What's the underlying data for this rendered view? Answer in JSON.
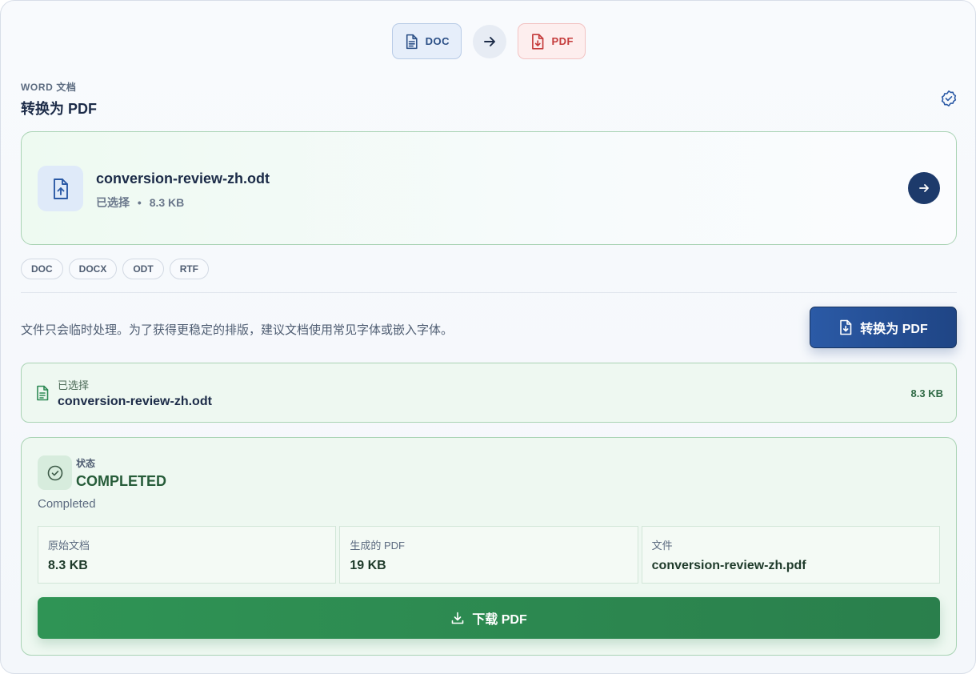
{
  "conversion": {
    "from_label": "DOC",
    "to_label": "PDF"
  },
  "header": {
    "eyebrow": "WORD 文档",
    "title": "转换为 PDF"
  },
  "file": {
    "name": "conversion-review-zh.odt",
    "status": "已选择",
    "separator": "•",
    "size": "8.3 KB"
  },
  "formats": [
    "DOC",
    "DOCX",
    "ODT",
    "RTF"
  ],
  "note": "文件只会临时处理。为了获得更稳定的排版，建议文档使用常见字体或嵌入字体。",
  "convert_button": "转换为 PDF",
  "selected": {
    "label": "已选择",
    "name": "conversion-review-zh.odt",
    "size": "8.3 KB"
  },
  "status": {
    "label": "状态",
    "value": "COMPLETED",
    "description": "Completed",
    "stats": [
      {
        "label": "原始文档",
        "value": "8.3 KB"
      },
      {
        "label": "生成的 PDF",
        "value": "19 KB"
      },
      {
        "label": "文件",
        "value": "conversion-review-zh.pdf"
      }
    ]
  },
  "download_button": "下载 PDF",
  "colors": {
    "primary": "#1f4585",
    "success": "#2a7f4c",
    "danger": "#c43a3a"
  },
  "icons": {
    "doc_chip": "document-icon",
    "pdf_chip": "pdf-download-icon",
    "arrow": "arrow-right-icon",
    "upload": "file-upload-icon",
    "check": "check-circle-icon",
    "download": "download-icon"
  }
}
